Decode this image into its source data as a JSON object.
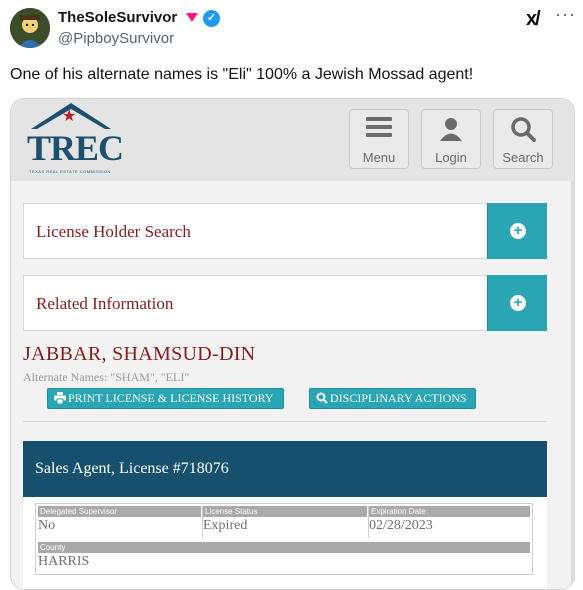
{
  "tweet": {
    "display_name": "TheSoleSurvivor",
    "handle": "@PipboySurvivor",
    "text": "One of his alternate names is \"Eli\" 100% a Jewish Mossad agent!",
    "grok_label": "x/",
    "more_label": "···",
    "verified_mark": "✓"
  },
  "trec": {
    "logo_text": "TREC",
    "logo_subtext": "TEXAS REAL ESTATE COMMISSION",
    "nav": [
      {
        "label": "Menu",
        "icon": "hamburger-icon"
      },
      {
        "label": "Login",
        "icon": "user-icon"
      },
      {
        "label": "Search",
        "icon": "search-icon"
      }
    ],
    "panels": [
      {
        "title": "License Holder Search",
        "icon": "plus-circle-icon"
      },
      {
        "title": "Related Information",
        "icon": "plus-circle-icon"
      }
    ],
    "holder": {
      "name": "JABBAR, SHAMSUD-DIN",
      "alternate_names": "Alternate Names: \"SHAM\", \"ELI\""
    },
    "actions": {
      "print": "PRINT LICENSE & LICENSE HISTORY",
      "disciplinary": "DISCIPLINARY ACTIONS"
    },
    "license": {
      "title": "Sales Agent, License #718076",
      "fields": {
        "supervisor_label": "Delegated Supervisor",
        "supervisor_value": "No",
        "status_label": "License Status",
        "status_value": "Expired",
        "expiration_label": "Expiration Date",
        "expiration_value": "02/28/2023",
        "county_label": "County",
        "county_value": "HARRIS"
      }
    }
  },
  "colors": {
    "brand_navy": "#17506c",
    "accent_teal": "#2aa5b4",
    "title_red": "#8b1a1a",
    "verified_blue": "#1d9bf0",
    "heart_pink": "#f91880"
  }
}
